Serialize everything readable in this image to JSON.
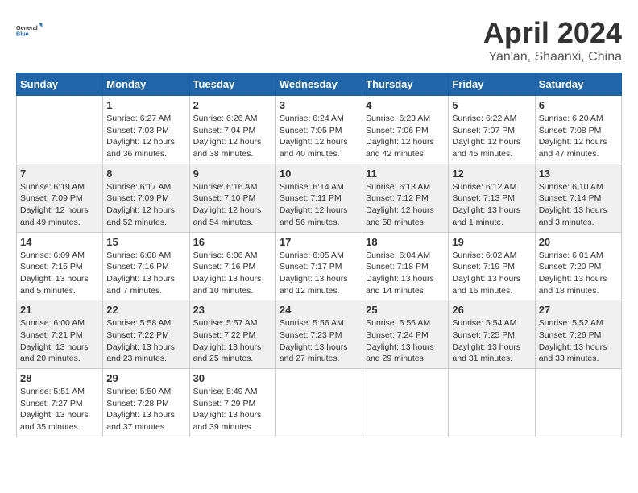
{
  "logo": {
    "general": "General",
    "blue": "Blue"
  },
  "header": {
    "month": "April 2024",
    "location": "Yan'an, Shaanxi, China"
  },
  "weekdays": [
    "Sunday",
    "Monday",
    "Tuesday",
    "Wednesday",
    "Thursday",
    "Friday",
    "Saturday"
  ],
  "weeks": [
    [
      null,
      {
        "day": "1",
        "sunrise": "6:27 AM",
        "sunset": "7:03 PM",
        "daylight": "12 hours and 36 minutes."
      },
      {
        "day": "2",
        "sunrise": "6:26 AM",
        "sunset": "7:04 PM",
        "daylight": "12 hours and 38 minutes."
      },
      {
        "day": "3",
        "sunrise": "6:24 AM",
        "sunset": "7:05 PM",
        "daylight": "12 hours and 40 minutes."
      },
      {
        "day": "4",
        "sunrise": "6:23 AM",
        "sunset": "7:06 PM",
        "daylight": "12 hours and 42 minutes."
      },
      {
        "day": "5",
        "sunrise": "6:22 AM",
        "sunset": "7:07 PM",
        "daylight": "12 hours and 45 minutes."
      },
      {
        "day": "6",
        "sunrise": "6:20 AM",
        "sunset": "7:08 PM",
        "daylight": "12 hours and 47 minutes."
      }
    ],
    [
      {
        "day": "7",
        "sunrise": "6:19 AM",
        "sunset": "7:09 PM",
        "daylight": "12 hours and 49 minutes."
      },
      {
        "day": "8",
        "sunrise": "6:17 AM",
        "sunset": "7:09 PM",
        "daylight": "12 hours and 52 minutes."
      },
      {
        "day": "9",
        "sunrise": "6:16 AM",
        "sunset": "7:10 PM",
        "daylight": "12 hours and 54 minutes."
      },
      {
        "day": "10",
        "sunrise": "6:14 AM",
        "sunset": "7:11 PM",
        "daylight": "12 hours and 56 minutes."
      },
      {
        "day": "11",
        "sunrise": "6:13 AM",
        "sunset": "7:12 PM",
        "daylight": "12 hours and 58 minutes."
      },
      {
        "day": "12",
        "sunrise": "6:12 AM",
        "sunset": "7:13 PM",
        "daylight": "13 hours and 1 minute."
      },
      {
        "day": "13",
        "sunrise": "6:10 AM",
        "sunset": "7:14 PM",
        "daylight": "13 hours and 3 minutes."
      }
    ],
    [
      {
        "day": "14",
        "sunrise": "6:09 AM",
        "sunset": "7:15 PM",
        "daylight": "13 hours and 5 minutes."
      },
      {
        "day": "15",
        "sunrise": "6:08 AM",
        "sunset": "7:16 PM",
        "daylight": "13 hours and 7 minutes."
      },
      {
        "day": "16",
        "sunrise": "6:06 AM",
        "sunset": "7:16 PM",
        "daylight": "13 hours and 10 minutes."
      },
      {
        "day": "17",
        "sunrise": "6:05 AM",
        "sunset": "7:17 PM",
        "daylight": "13 hours and 12 minutes."
      },
      {
        "day": "18",
        "sunrise": "6:04 AM",
        "sunset": "7:18 PM",
        "daylight": "13 hours and 14 minutes."
      },
      {
        "day": "19",
        "sunrise": "6:02 AM",
        "sunset": "7:19 PM",
        "daylight": "13 hours and 16 minutes."
      },
      {
        "day": "20",
        "sunrise": "6:01 AM",
        "sunset": "7:20 PM",
        "daylight": "13 hours and 18 minutes."
      }
    ],
    [
      {
        "day": "21",
        "sunrise": "6:00 AM",
        "sunset": "7:21 PM",
        "daylight": "13 hours and 20 minutes."
      },
      {
        "day": "22",
        "sunrise": "5:58 AM",
        "sunset": "7:22 PM",
        "daylight": "13 hours and 23 minutes."
      },
      {
        "day": "23",
        "sunrise": "5:57 AM",
        "sunset": "7:22 PM",
        "daylight": "13 hours and 25 minutes."
      },
      {
        "day": "24",
        "sunrise": "5:56 AM",
        "sunset": "7:23 PM",
        "daylight": "13 hours and 27 minutes."
      },
      {
        "day": "25",
        "sunrise": "5:55 AM",
        "sunset": "7:24 PM",
        "daylight": "13 hours and 29 minutes."
      },
      {
        "day": "26",
        "sunrise": "5:54 AM",
        "sunset": "7:25 PM",
        "daylight": "13 hours and 31 minutes."
      },
      {
        "day": "27",
        "sunrise": "5:52 AM",
        "sunset": "7:26 PM",
        "daylight": "13 hours and 33 minutes."
      }
    ],
    [
      {
        "day": "28",
        "sunrise": "5:51 AM",
        "sunset": "7:27 PM",
        "daylight": "13 hours and 35 minutes."
      },
      {
        "day": "29",
        "sunrise": "5:50 AM",
        "sunset": "7:28 PM",
        "daylight": "13 hours and 37 minutes."
      },
      {
        "day": "30",
        "sunrise": "5:49 AM",
        "sunset": "7:29 PM",
        "daylight": "13 hours and 39 minutes."
      },
      null,
      null,
      null,
      null
    ]
  ],
  "labels": {
    "sunrise": "Sunrise:",
    "sunset": "Sunset:",
    "daylight": "Daylight:"
  }
}
